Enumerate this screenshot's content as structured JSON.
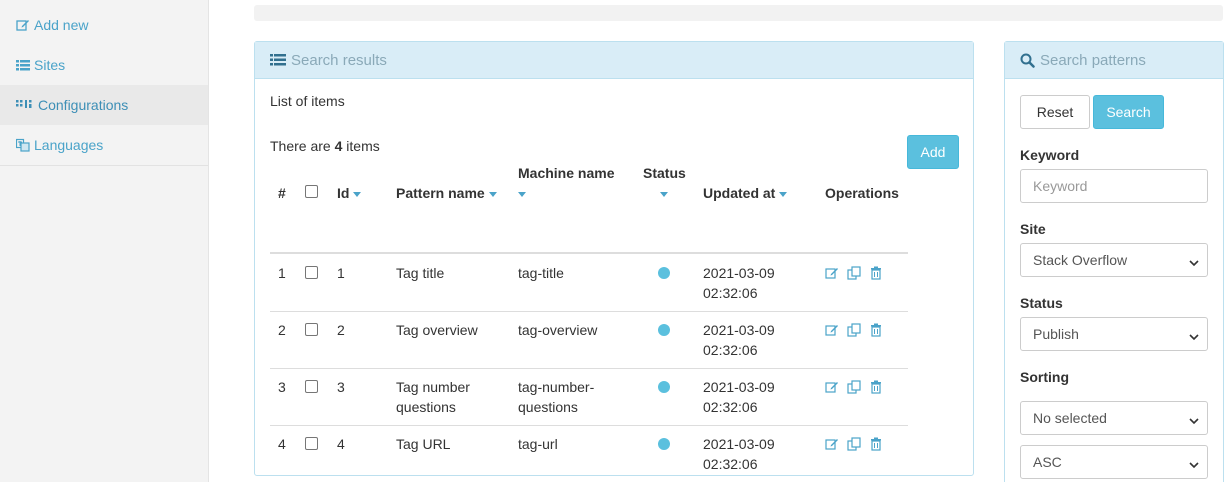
{
  "sidebar": {
    "items": [
      {
        "label": "Add new",
        "icon": "edit-icon"
      },
      {
        "label": "Sites",
        "icon": "list-icon"
      },
      {
        "label": "Configurations",
        "icon": "grid-icon"
      },
      {
        "label": "Languages",
        "icon": "translate-icon"
      }
    ]
  },
  "results": {
    "title": "Search results",
    "list_title": "List of items",
    "count_prefix": "There are",
    "count": "4",
    "count_suffix": "items",
    "add_label": "Add",
    "columns": {
      "num": "#",
      "id": "Id",
      "pattern_name": "Pattern name",
      "machine_name": "Machine name",
      "status": "Status",
      "updated_at": "Updated at",
      "operations": "Operations"
    },
    "rows": [
      {
        "num": "1",
        "id": "1",
        "name_l1": "Tag title",
        "name_l2": "",
        "machine_l1": "tag-title",
        "machine_l2": "",
        "date": "2021-03-09",
        "time": "02:32:06"
      },
      {
        "num": "2",
        "id": "2",
        "name_l1": "Tag overview",
        "name_l2": "",
        "machine_l1": "tag-overview",
        "machine_l2": "",
        "date": "2021-03-09",
        "time": "02:32:06"
      },
      {
        "num": "3",
        "id": "3",
        "name_l1": "Tag number",
        "name_l2": "questions",
        "machine_l1": "tag-number-",
        "machine_l2": "questions",
        "date": "2021-03-09",
        "time": "02:32:06"
      },
      {
        "num": "4",
        "id": "4",
        "name_l1": "Tag URL",
        "name_l2": "",
        "machine_l1": "tag-url",
        "machine_l2": "",
        "date": "2021-03-09",
        "time": "02:32:06"
      }
    ]
  },
  "patterns": {
    "title": "Search patterns",
    "reset_label": "Reset",
    "search_label": "Search",
    "keyword_label": "Keyword",
    "keyword_placeholder": "Keyword",
    "site_label": "Site",
    "site_value": "Stack Overflow",
    "status_label": "Status",
    "status_value": "Publish",
    "sorting_label": "Sorting",
    "sorting_value": "No selected",
    "order_value": "ASC"
  },
  "colors": {
    "accent": "#5bc0de",
    "link": "#4aa3c9",
    "panel_header": "#d9edf7"
  }
}
